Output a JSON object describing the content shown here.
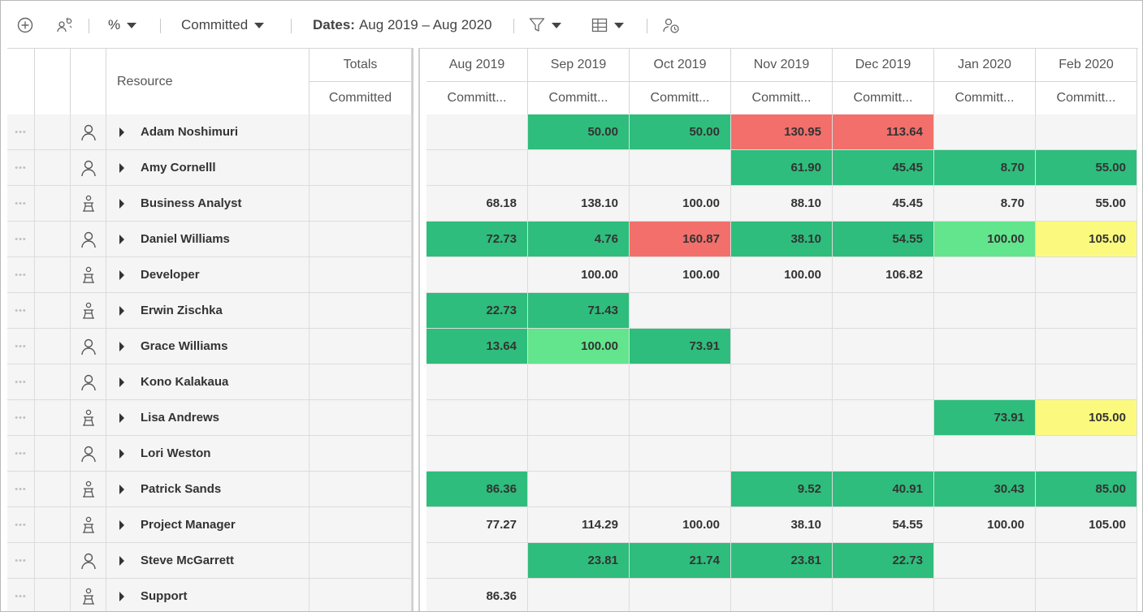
{
  "toolbar": {
    "percent_label": "%",
    "committed_label": "Committed",
    "dates_prefix": "Dates:",
    "dates_value": "Aug 2019 – Aug 2020",
    "icons": [
      "add-circle-icon",
      "resource-swap-icon",
      "filter-icon",
      "grid-layout-icon",
      "resource-clock-icon"
    ]
  },
  "header": {
    "resource": "Resource",
    "totals": "Totals",
    "totals_sub": "Committed",
    "months": [
      {
        "label": "Aug 2019",
        "sub": "Committ..."
      },
      {
        "label": "Sep 2019",
        "sub": "Committ..."
      },
      {
        "label": "Oct 2019",
        "sub": "Committ..."
      },
      {
        "label": "Nov 2019",
        "sub": "Committ..."
      },
      {
        "label": "Dec 2019",
        "sub": "Committ..."
      },
      {
        "label": "Jan 2020",
        "sub": "Committ..."
      },
      {
        "label": "Feb 2020",
        "sub": "Committ..."
      }
    ]
  },
  "colors": {
    "green": "#2ebd7c",
    "light_green": "#62e58c",
    "red": "#f26f6b",
    "yellow": "#fcfa7e",
    "neutral": "#f5f5f5"
  },
  "rows": [
    {
      "name": "Adam Noshimuri",
      "type": "person",
      "cells": [
        {
          "v": "",
          "c": "neutral"
        },
        {
          "v": "50.00",
          "c": "green"
        },
        {
          "v": "50.00",
          "c": "green"
        },
        {
          "v": "130.95",
          "c": "red"
        },
        {
          "v": "113.64",
          "c": "red"
        },
        {
          "v": "",
          "c": "neutral"
        },
        {
          "v": "",
          "c": "neutral"
        }
      ]
    },
    {
      "name": "Amy Cornelll",
      "type": "person",
      "cells": [
        {
          "v": "",
          "c": "neutral"
        },
        {
          "v": "",
          "c": "neutral"
        },
        {
          "v": "",
          "c": "neutral"
        },
        {
          "v": "61.90",
          "c": "green"
        },
        {
          "v": "45.45",
          "c": "green"
        },
        {
          "v": "8.70",
          "c": "green"
        },
        {
          "v": "55.00",
          "c": "green"
        }
      ]
    },
    {
      "name": "Business Analyst",
      "type": "role",
      "cells": [
        {
          "v": "68.18",
          "c": "neutral"
        },
        {
          "v": "138.10",
          "c": "neutral"
        },
        {
          "v": "100.00",
          "c": "neutral"
        },
        {
          "v": "88.10",
          "c": "neutral"
        },
        {
          "v": "45.45",
          "c": "neutral"
        },
        {
          "v": "8.70",
          "c": "neutral"
        },
        {
          "v": "55.00",
          "c": "neutral"
        }
      ]
    },
    {
      "name": "Daniel Williams",
      "type": "person",
      "cells": [
        {
          "v": "72.73",
          "c": "green"
        },
        {
          "v": "4.76",
          "c": "green"
        },
        {
          "v": "160.87",
          "c": "red"
        },
        {
          "v": "38.10",
          "c": "green"
        },
        {
          "v": "54.55",
          "c": "green"
        },
        {
          "v": "100.00",
          "c": "light_green"
        },
        {
          "v": "105.00",
          "c": "yellow"
        }
      ]
    },
    {
      "name": "Developer",
      "type": "role",
      "cells": [
        {
          "v": "",
          "c": "neutral"
        },
        {
          "v": "100.00",
          "c": "neutral"
        },
        {
          "v": "100.00",
          "c": "neutral"
        },
        {
          "v": "100.00",
          "c": "neutral"
        },
        {
          "v": "106.82",
          "c": "neutral"
        },
        {
          "v": "",
          "c": "neutral"
        },
        {
          "v": "",
          "c": "neutral"
        }
      ]
    },
    {
      "name": "Erwin Zischka",
      "type": "role",
      "cells": [
        {
          "v": "22.73",
          "c": "green"
        },
        {
          "v": "71.43",
          "c": "green"
        },
        {
          "v": "",
          "c": "neutral"
        },
        {
          "v": "",
          "c": "neutral"
        },
        {
          "v": "",
          "c": "neutral"
        },
        {
          "v": "",
          "c": "neutral"
        },
        {
          "v": "",
          "c": "neutral"
        }
      ]
    },
    {
      "name": "Grace Williams",
      "type": "person",
      "cells": [
        {
          "v": "13.64",
          "c": "green"
        },
        {
          "v": "100.00",
          "c": "light_green"
        },
        {
          "v": "73.91",
          "c": "green"
        },
        {
          "v": "",
          "c": "neutral"
        },
        {
          "v": "",
          "c": "neutral"
        },
        {
          "v": "",
          "c": "neutral"
        },
        {
          "v": "",
          "c": "neutral"
        }
      ]
    },
    {
      "name": "Kono Kalakaua",
      "type": "person",
      "cells": [
        {
          "v": "",
          "c": "neutral"
        },
        {
          "v": "",
          "c": "neutral"
        },
        {
          "v": "",
          "c": "neutral"
        },
        {
          "v": "",
          "c": "neutral"
        },
        {
          "v": "",
          "c": "neutral"
        },
        {
          "v": "",
          "c": "neutral"
        },
        {
          "v": "",
          "c": "neutral"
        }
      ]
    },
    {
      "name": "Lisa Andrews",
      "type": "role",
      "cells": [
        {
          "v": "",
          "c": "neutral"
        },
        {
          "v": "",
          "c": "neutral"
        },
        {
          "v": "",
          "c": "neutral"
        },
        {
          "v": "",
          "c": "neutral"
        },
        {
          "v": "",
          "c": "neutral"
        },
        {
          "v": "73.91",
          "c": "green"
        },
        {
          "v": "105.00",
          "c": "yellow"
        }
      ]
    },
    {
      "name": "Lori Weston",
      "type": "person",
      "cells": [
        {
          "v": "",
          "c": "neutral"
        },
        {
          "v": "",
          "c": "neutral"
        },
        {
          "v": "",
          "c": "neutral"
        },
        {
          "v": "",
          "c": "neutral"
        },
        {
          "v": "",
          "c": "neutral"
        },
        {
          "v": "",
          "c": "neutral"
        },
        {
          "v": "",
          "c": "neutral"
        }
      ]
    },
    {
      "name": "Patrick Sands",
      "type": "role",
      "cells": [
        {
          "v": "86.36",
          "c": "green"
        },
        {
          "v": "",
          "c": "neutral"
        },
        {
          "v": "",
          "c": "neutral"
        },
        {
          "v": "9.52",
          "c": "green"
        },
        {
          "v": "40.91",
          "c": "green"
        },
        {
          "v": "30.43",
          "c": "green"
        },
        {
          "v": "85.00",
          "c": "green"
        }
      ]
    },
    {
      "name": "Project Manager",
      "type": "role",
      "cells": [
        {
          "v": "77.27",
          "c": "neutral"
        },
        {
          "v": "114.29",
          "c": "neutral"
        },
        {
          "v": "100.00",
          "c": "neutral"
        },
        {
          "v": "38.10",
          "c": "neutral"
        },
        {
          "v": "54.55",
          "c": "neutral"
        },
        {
          "v": "100.00",
          "c": "neutral"
        },
        {
          "v": "105.00",
          "c": "neutral"
        }
      ]
    },
    {
      "name": "Steve McGarrett",
      "type": "person",
      "cells": [
        {
          "v": "",
          "c": "neutral"
        },
        {
          "v": "23.81",
          "c": "green"
        },
        {
          "v": "21.74",
          "c": "green"
        },
        {
          "v": "23.81",
          "c": "green"
        },
        {
          "v": "22.73",
          "c": "green"
        },
        {
          "v": "",
          "c": "neutral"
        },
        {
          "v": "",
          "c": "neutral"
        }
      ]
    },
    {
      "name": "Support",
      "type": "role",
      "cells": [
        {
          "v": "86.36",
          "c": "neutral"
        },
        {
          "v": "",
          "c": "neutral"
        },
        {
          "v": "",
          "c": "neutral"
        },
        {
          "v": "",
          "c": "neutral"
        },
        {
          "v": "",
          "c": "neutral"
        },
        {
          "v": "",
          "c": "neutral"
        },
        {
          "v": "",
          "c": "neutral"
        }
      ]
    }
  ]
}
